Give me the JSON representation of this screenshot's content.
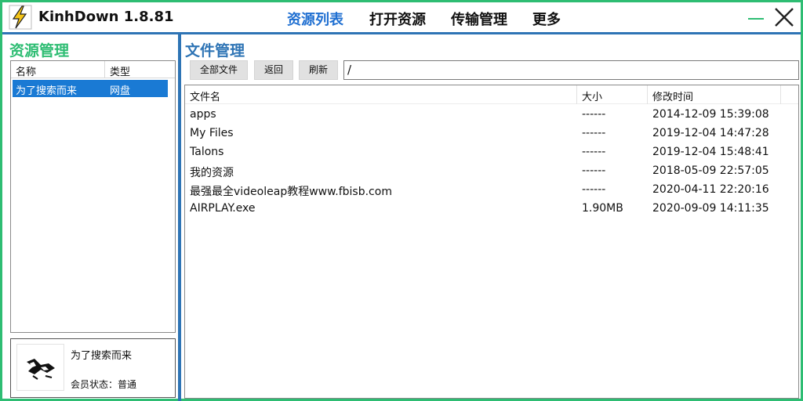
{
  "app": {
    "title": "KinhDown 1.8.81"
  },
  "nav": {
    "items": [
      {
        "label": "资源列表",
        "active": true
      },
      {
        "label": "打开资源",
        "active": false
      },
      {
        "label": "传输管理",
        "active": false
      },
      {
        "label": "更多",
        "active": false
      }
    ]
  },
  "window_controls": {
    "minimize_icon": "minimize-icon",
    "close_icon": "close-icon"
  },
  "left_panel": {
    "title": "资源管理",
    "columns": [
      "名称",
      "类型"
    ],
    "rows": [
      {
        "name": "为了搜索而来",
        "type": "网盘",
        "selected": true
      }
    ],
    "user": {
      "name": "为了搜索而来",
      "status": "会员状态：普通"
    }
  },
  "right_panel": {
    "title": "文件管理",
    "buttons": {
      "all_files": "全部文件",
      "back": "返回",
      "refresh": "刷新"
    },
    "path": "/",
    "columns": {
      "name": "文件名",
      "size": "大小",
      "modified": "修改时间"
    },
    "files": [
      {
        "name": "apps",
        "size": "------",
        "modified": "2014-12-09 15:39:08"
      },
      {
        "name": "My Files",
        "size": "------",
        "modified": "2019-12-04 14:47:28"
      },
      {
        "name": "Talons",
        "size": "------",
        "modified": "2019-12-04 15:48:41"
      },
      {
        "name": "我的资源",
        "size": "------",
        "modified": "2018-05-09 22:57:05"
      },
      {
        "name": "最强最全videoleap教程www.fbisb.com",
        "size": "------",
        "modified": "2020-04-11 22:20:16"
      },
      {
        "name": "AIRPLAY.exe",
        "size": "1.90MB",
        "modified": "2020-09-09 14:11:35"
      }
    ]
  },
  "colors": {
    "accent_green": "#2ebd73",
    "accent_blue": "#2e74b5",
    "active_nav": "#1f6fd1",
    "selection": "#1a7ad4"
  }
}
